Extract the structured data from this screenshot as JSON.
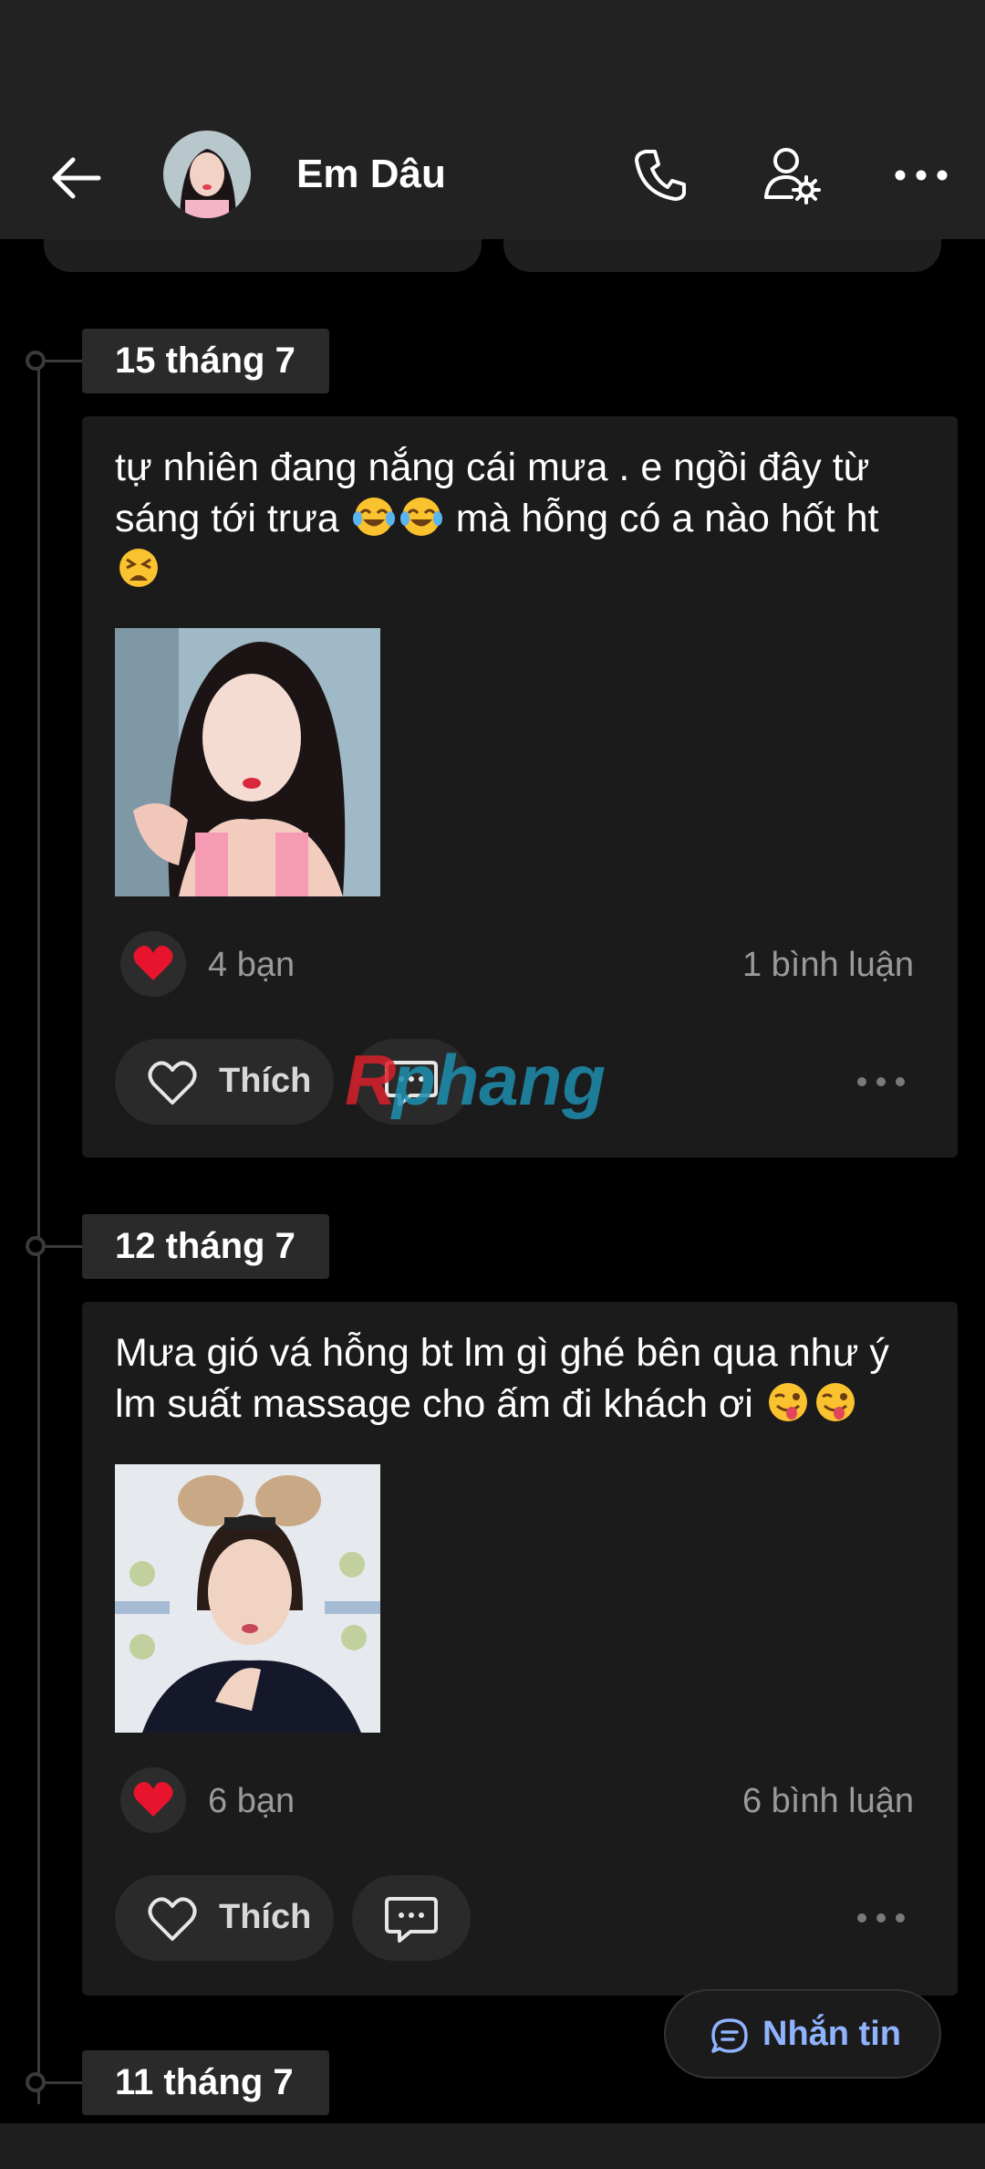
{
  "header": {
    "title": "Em Dâu",
    "icons": [
      "back-arrow-icon",
      "phone-icon",
      "user-settings-icon",
      "more-icon"
    ]
  },
  "posts": [
    {
      "date": "15 tháng 7",
      "text_line1": "tự nhiên đang nắng cái mưa . e ngồi đây từ",
      "text_line2a": "sáng tới trưa",
      "text_line2b": "mà hỗng có a nào hốt ht",
      "emojis": [
        "tears-of-joy",
        "tears-of-joy",
        "tired-face"
      ],
      "likes": "4 bạn",
      "comments": "1 bình luận",
      "like_label": "Thích"
    },
    {
      "date": "12 tháng 7",
      "text_line1": "Mưa gió vá hỗng bt lm gì ghé bên qua như ý",
      "text_line2": "lm suất massage cho ấm đi khách ơi",
      "emojis": [
        "winking-tongue",
        "winking-tongue"
      ],
      "likes": "6 bạn",
      "comments": "6 bình luận",
      "like_label": "Thích"
    }
  ],
  "next_date": "11 tháng 7",
  "message_button": "Nhắn tin",
  "watermark": "Rphang",
  "colors": {
    "header_bg": "#222222",
    "card_bg": "#1b1b1b",
    "accent_blue": "#8fb3ff",
    "heart_red": "#e8132d"
  }
}
